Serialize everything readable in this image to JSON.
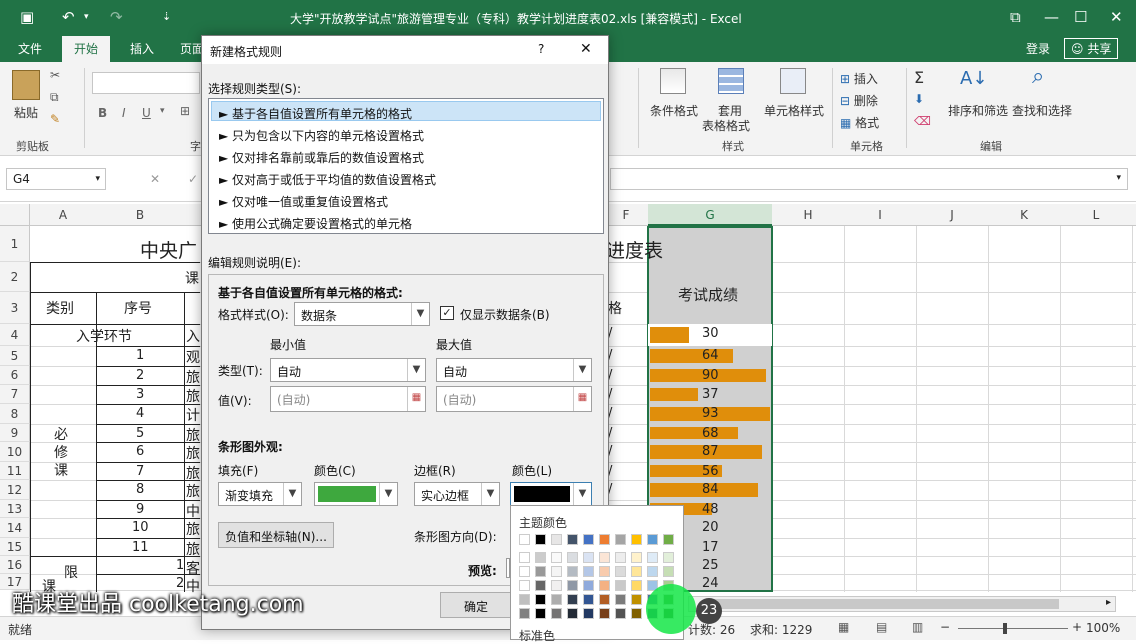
{
  "window": {
    "title": "大学\"开放教学试点\"旅游管理专业（专科）教学计划进度表02.xls  [兼容模式] - Excel",
    "login_label": "登录",
    "share_label": "共享"
  },
  "tabs": [
    "文件",
    "开始",
    "插入",
    "页面"
  ],
  "ribbon": {
    "paste_label": "粘贴",
    "clipboard_group": "剪贴板",
    "font_group_partial": "字",
    "conditional_format_label": "条件格式",
    "table_format_label_1": "套用",
    "table_format_label_2": "表格格式",
    "cell_style_label": "单元格样式",
    "style_group": "样式",
    "insert_label": "插入",
    "delete_label": "删除",
    "format_label": "格式",
    "cells_group": "单元格",
    "sort_filter_label": "排序和筛选",
    "find_select_label": "查找和选择",
    "edit_group": "编辑"
  },
  "formula_bar": {
    "name_box": "G4"
  },
  "columns": [
    "A",
    "B",
    "F",
    "G",
    "H",
    "I",
    "J",
    "K",
    "L"
  ],
  "rows": [
    "1",
    "2",
    "3",
    "4",
    "5",
    "6",
    "7",
    "8",
    "9",
    "10",
    "11",
    "12",
    "13",
    "14",
    "15",
    "16",
    "17"
  ],
  "sheet": {
    "title_left": "中央广",
    "title_right": "进度表",
    "row2_partial": "课",
    "header_category": "类别",
    "header_seq": "序号",
    "header_f_partial": "格",
    "header_score": "考试成绩",
    "row4_label": "入学环节",
    "row4_c_partial": "入",
    "bixiu": [
      "必",
      "修",
      "课"
    ],
    "seq_numbers": [
      "1",
      "2",
      "3",
      "4",
      "5",
      "6",
      "7",
      "8",
      "9",
      "10",
      "11"
    ],
    "c_partials": [
      "观",
      "旅",
      "旅",
      "计",
      "旅",
      "旅",
      "旅",
      "旅",
      "中",
      "旅",
      "旅"
    ],
    "row16_a": "限",
    "row17_a": "课",
    "row16_b": "1",
    "row17_b": "2",
    "row16_c": "客",
    "row17_c": "中",
    "f_marks": [
      "/",
      "/",
      "/",
      "/",
      "/",
      "/",
      "/",
      "/",
      "/"
    ],
    "scores": [
      30,
      64,
      90,
      37,
      93,
      68,
      87,
      56,
      84,
      48,
      20,
      17,
      25,
      24
    ]
  },
  "dialog": {
    "title": "新建格式规则",
    "help_label": "?",
    "close_label": "✕",
    "select_type_label": "选择规则类型(S):",
    "rule_types": [
      "► 基于各自值设置所有单元格的格式",
      "► 只为包含以下内容的单元格设置格式",
      "► 仅对排名靠前或靠后的数值设置格式",
      "► 仅对高于或低于平均值的数值设置格式",
      "► 仅对唯一值或重复值设置格式",
      "► 使用公式确定要设置格式的单元格"
    ],
    "edit_desc_label": "编辑规则说明(E):",
    "format_all_label": "基于各自值设置所有单元格的格式:",
    "format_style_label": "格式样式(O):",
    "format_style_value": "数据条",
    "show_bar_only_label": "仅显示数据条(B)",
    "min_label": "最小值",
    "max_label": "最大值",
    "type_label": "类型(T):",
    "min_type": "自动",
    "max_type": "自动",
    "value_label": "值(V):",
    "min_value_placeholder": "(自动)",
    "max_value_placeholder": "(自动)",
    "bar_appearance_label": "条形图外观:",
    "fill_label": "填充(F)",
    "color_label_1": "颜色(C)",
    "border_label": "边框(R)",
    "color_label_2": "颜色(L)",
    "fill_value": "渐变填充",
    "border_value": "实心边框",
    "neg_axis_button": "负值和坐标轴(N)...",
    "bar_direction_label": "条形图方向(D):",
    "preview_label": "预览:",
    "ok_label": "确定",
    "fill_color": "#3ea83e",
    "border_color": "#000000"
  },
  "palette": {
    "theme_label": "主题颜色",
    "standard_label": "标准色",
    "theme_top": [
      "#ffffff",
      "#000000",
      "#e7e6e6",
      "#44546a",
      "#4472c4",
      "#ed7d31",
      "#a5a5a5",
      "#ffc000",
      "#5b9bd5",
      "#70ad47"
    ]
  },
  "status": {
    "ready": "就绪",
    "count": "计数: 26",
    "sum": "求和: 1229",
    "zoom": "100%"
  },
  "watermark": {
    "text": "酷课堂出品 coolketang.com",
    "badge": "23"
  },
  "colors": {
    "excel_green": "#217346",
    "bar_orange": "#e08e0b",
    "selection_gray": "#d0d0d0"
  }
}
